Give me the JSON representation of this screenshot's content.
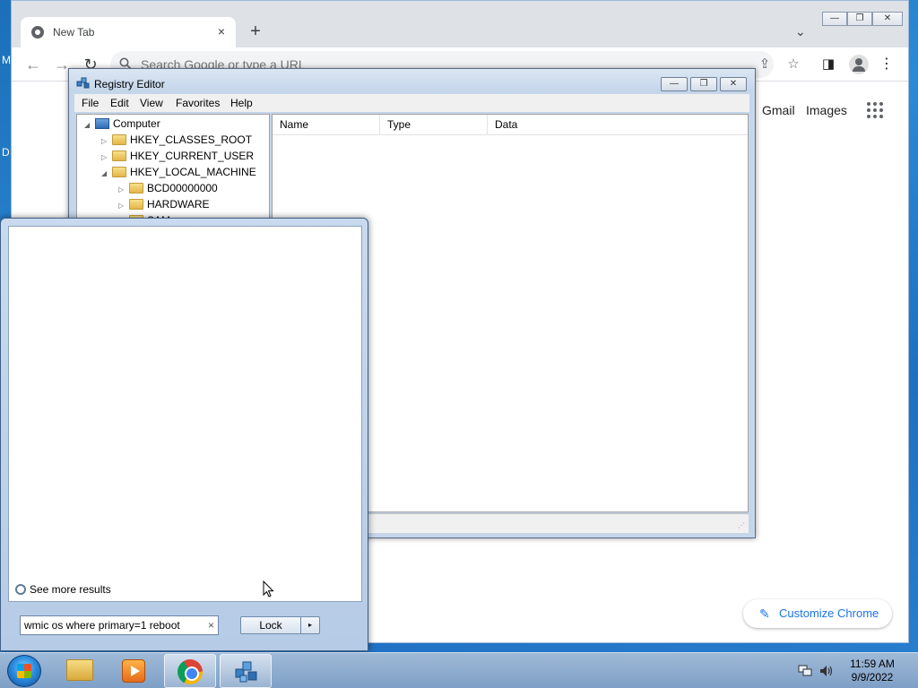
{
  "desktop": {
    "edge_letters": [
      "M",
      "D"
    ]
  },
  "chrome": {
    "tab_title": "New Tab",
    "tab_close": "×",
    "new_tab": "+",
    "tab_dropdown": "⌄",
    "window_controls": {
      "minimize": "—",
      "restore": "❐",
      "close": "✕"
    },
    "back": "←",
    "forward": "→",
    "reload": "↻",
    "omnibox_placeholder": "Search Google or type a URL",
    "share": "⇪",
    "bookmark": "☆",
    "side_panel": "◨",
    "menu": "⋮",
    "links": {
      "gmail": "Gmail",
      "images": "Images"
    },
    "customize_label": "Customize Chrome",
    "customize_icon": "✎"
  },
  "regedit": {
    "title": "Registry Editor",
    "window_controls": {
      "minimize": "—",
      "restore": "❐",
      "close": "✕"
    },
    "menu": [
      "File",
      "Edit",
      "View",
      "Favorites",
      "Help"
    ],
    "tree": [
      {
        "label": "Computer",
        "arrow": "◢",
        "icon": "computer-icon",
        "level": 0
      },
      {
        "label": "HKEY_CLASSES_ROOT",
        "arrow": "▷",
        "icon": "folder-icon",
        "level": 1
      },
      {
        "label": "HKEY_CURRENT_USER",
        "arrow": "▷",
        "icon": "folder-icon",
        "level": 1
      },
      {
        "label": "HKEY_LOCAL_MACHINE",
        "arrow": "◢",
        "icon": "folder-icon",
        "level": 1
      },
      {
        "label": "BCD00000000",
        "arrow": "▷",
        "icon": "folder-icon",
        "level": 2
      },
      {
        "label": "HARDWARE",
        "arrow": "▷",
        "icon": "folder-icon",
        "level": 2
      },
      {
        "label": "SAM",
        "arrow": "",
        "icon": "folder-icon",
        "level": 2
      }
    ],
    "columns": [
      "Name",
      "Type",
      "Data"
    ]
  },
  "start_menu": {
    "see_more": "See more results",
    "search_value": "wmic os where primary=1 reboot",
    "search_clear": "×",
    "lock_label": "Lock",
    "lock_arrow": "▸"
  },
  "taskbar": {
    "apps": [
      "windows-explorer",
      "media-player",
      "google-chrome",
      "registry-editor"
    ],
    "active_apps": [
      "google-chrome",
      "registry-editor"
    ],
    "time": "11:59 AM",
    "date": "9/9/2022"
  }
}
